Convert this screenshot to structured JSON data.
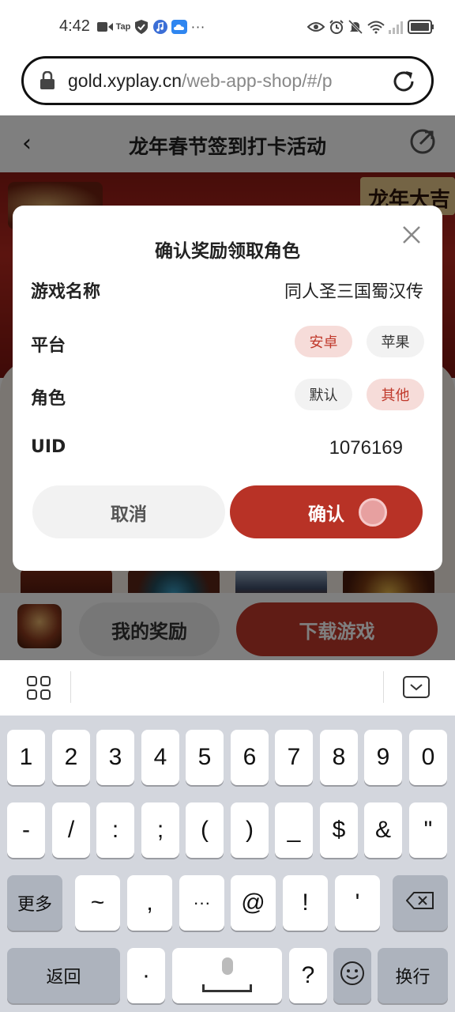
{
  "status_bar": {
    "time": "4:42",
    "left_icons": [
      "video-icon",
      "tap-icon",
      "shield-icon",
      "music-icon",
      "cloud-icon",
      "more-dots-icon"
    ],
    "tap_text": "Tap",
    "dots_text": "···",
    "right_icons": [
      "eye-icon",
      "alarm-icon",
      "mute-icon",
      "wifi-icon",
      "signal-icon",
      "battery-icon"
    ]
  },
  "browser": {
    "url_domain": "gold.xyplay.cn",
    "url_path": "/web-app-shop/#/p"
  },
  "page": {
    "title": "龙年春节签到打卡活动",
    "back_glyph": "‹",
    "banner_text": "龙年大吉",
    "my_rewards_label": "我的奖励",
    "download_label": "下载游戏"
  },
  "modal": {
    "title": "确认奖励领取角色",
    "rows": {
      "game_name_label": "游戏名称",
      "game_name_value": "同人圣三国蜀汉传",
      "platform_label": "平台",
      "platform_options": [
        "安卓",
        "苹果"
      ],
      "platform_selected": "安卓",
      "role_label": "角色",
      "role_options": [
        "默认",
        "其他"
      ],
      "role_selected": "其他",
      "uid_label": "UID",
      "uid_value": "1076169"
    },
    "cancel_label": "取消",
    "confirm_label": "确认",
    "accent_color": "#c0392b"
  },
  "keyboard": {
    "row1": [
      "1",
      "2",
      "3",
      "4",
      "5",
      "6",
      "7",
      "8",
      "9",
      "0"
    ],
    "row2": [
      "-",
      "/",
      ":",
      ";",
      "(",
      ")",
      "_",
      "$",
      "&",
      "\""
    ],
    "row3": {
      "more_label": "更多",
      "keys": [
        "~",
        ",",
        "···",
        "@",
        "!",
        "'"
      ],
      "delete_icon": "backspace-icon"
    },
    "row4": {
      "back_label": "返回",
      "dot": "·",
      "question": "?",
      "emoji_icon": "emoji-icon",
      "return_label": "换行"
    }
  }
}
